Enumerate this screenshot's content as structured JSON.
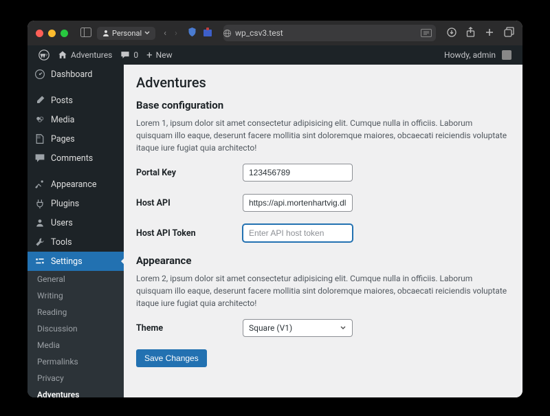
{
  "chrome": {
    "profile": "Personal",
    "url": "wp_csv3.test"
  },
  "wpbar": {
    "site_name": "Adventures",
    "comment_count": "0",
    "new": "New",
    "greeting": "Howdy, admin"
  },
  "sidebar": {
    "dashboard": "Dashboard",
    "posts": "Posts",
    "media": "Media",
    "pages": "Pages",
    "comments": "Comments",
    "appearance": "Appearance",
    "plugins": "Plugins",
    "users": "Users",
    "tools": "Tools",
    "settings": "Settings",
    "submenu": {
      "general": "General",
      "writing": "Writing",
      "reading": "Reading",
      "discussion": "Discussion",
      "media": "Media",
      "permalinks": "Permalinks",
      "privacy": "Privacy",
      "adventures": "Adventures"
    }
  },
  "page": {
    "title": "Adventures",
    "section1_title": "Base configuration",
    "section1_desc": "Lorem 1, ipsum dolor sit amet consectetur adipisicing elit. Cumque nulla in officiis. Laborum quisquam illo eaque, deserunt facere mollitia sint doloremque maiores, obcaecati reiciendis voluptate itaque iure fugiat quia architecto!",
    "portal_key_label": "Portal Key",
    "portal_key_value": "123456789",
    "host_api_label": "Host API",
    "host_api_value": "https://api.mortenhartvig.dl",
    "host_token_label": "Host API Token",
    "host_token_placeholder": "Enter API host token",
    "section2_title": "Appearance",
    "section2_desc": "Lorem 2, ipsum dolor sit amet consectetur adipisicing elit. Cumque nulla in officiis. Laborum quisquam illo eaque, deserunt facere mollitia sint doloremque maiores, obcaecati reiciendis voluptate itaque iure fugiat quia architecto!",
    "theme_label": "Theme",
    "theme_value": "Square (V1)",
    "save": "Save Changes"
  }
}
